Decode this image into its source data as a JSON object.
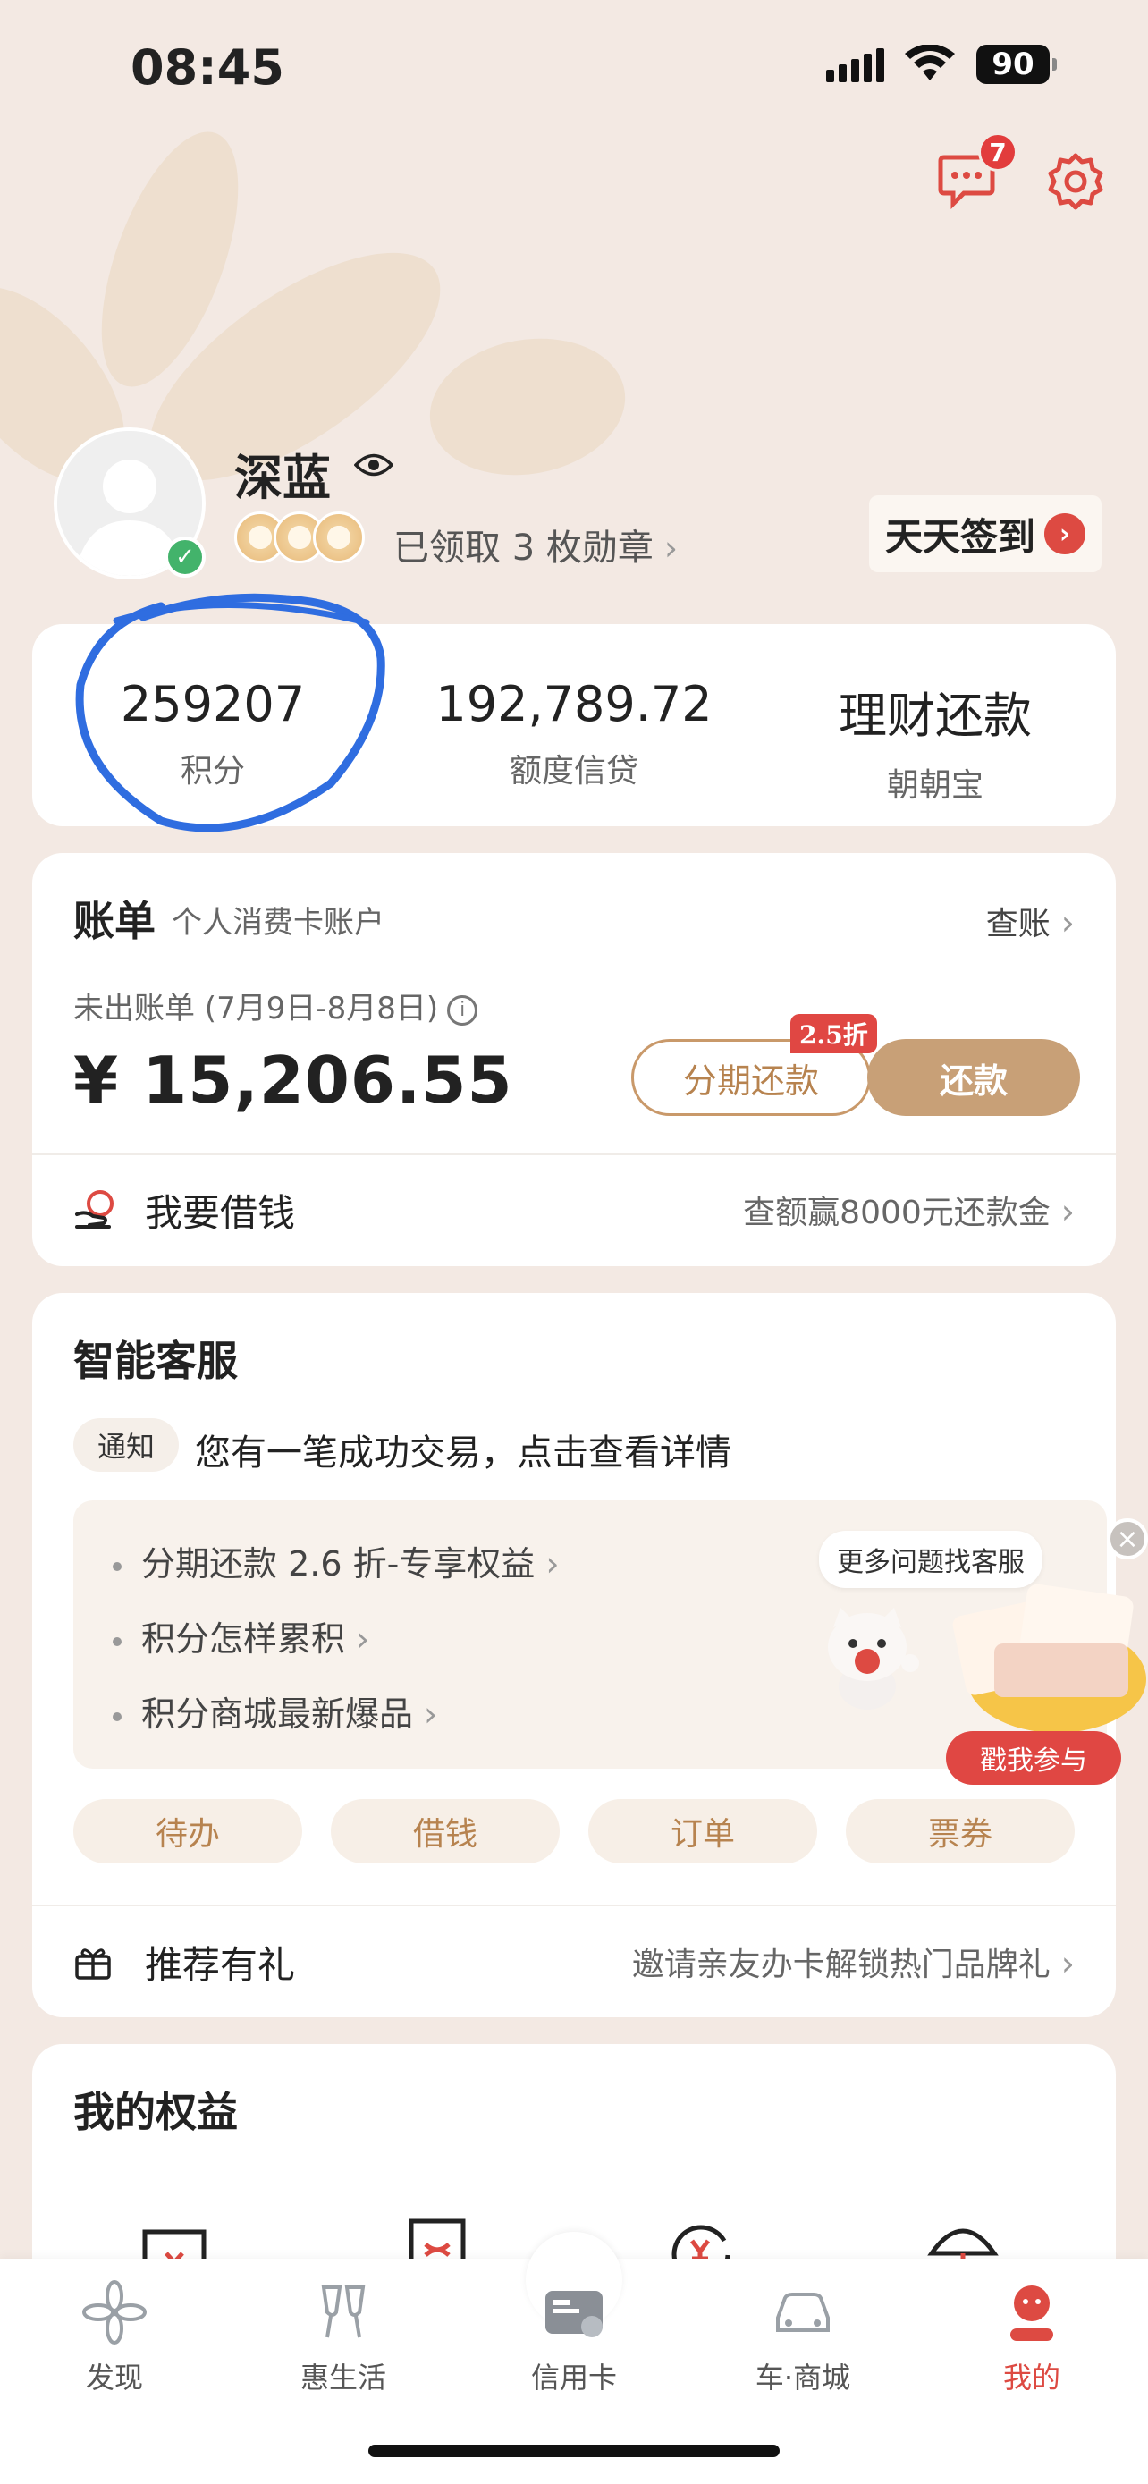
{
  "status_bar": {
    "time": "08:45",
    "battery": "90"
  },
  "header": {
    "message_badge": "7"
  },
  "profile": {
    "name": "深蓝",
    "medals_text": "已领取 3 枚勋章",
    "signin_label": "天天签到"
  },
  "stats": [
    {
      "value": "259207",
      "label": "积分"
    },
    {
      "value": "192,789.72",
      "label": "额度信贷"
    },
    {
      "value": "理财还款",
      "label": "朝朝宝"
    }
  ],
  "bill": {
    "title": "账单",
    "subtitle": "个人消费卡账户",
    "check_label": "查账",
    "period": "未出账单 (7月9日-8月8日)",
    "amount": "¥ 15,206.55",
    "installment_label": "分期还款",
    "discount_badge": "2.5折",
    "repay_label": "还款",
    "borrow_label": "我要借钱",
    "borrow_promo": "查额赢8000元还款金"
  },
  "service": {
    "title": "智能客服",
    "notice_tag": "通知",
    "notice_text": "您有一笔成功交易，点击查看详情",
    "faq": [
      "分期还款 2.6 折-专享权益",
      "积分怎样累积",
      "积分商城最新爆品"
    ],
    "bubble": "更多问题找客服",
    "join_label": "戳我参与",
    "chips": [
      "待办",
      "借钱",
      "订单",
      "票券"
    ],
    "refer_label": "推荐有礼",
    "refer_promo": "邀请亲友办卡解锁热门品牌礼"
  },
  "benefits": {
    "title": "我的权益"
  },
  "tabs": [
    {
      "label": "发现",
      "icon": "flower-icon"
    },
    {
      "label": "惠生活",
      "icon": "cheers-icon"
    },
    {
      "label": "信用卡",
      "icon": "credit-card-icon"
    },
    {
      "label": "车·商城",
      "icon": "car-icon"
    },
    {
      "label": "我的",
      "icon": "profile-icon"
    }
  ],
  "colors": {
    "accent": "#c8a077",
    "red": "#dd4a42",
    "background": "#f3e9e3"
  }
}
